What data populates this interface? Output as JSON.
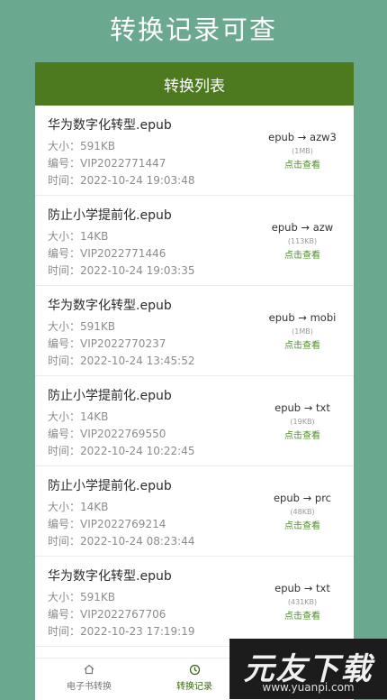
{
  "headline": "转换记录可查",
  "card": {
    "title": "转换列表"
  },
  "labels": {
    "size": "大小：",
    "id": "编号：",
    "time": "时间："
  },
  "records": [
    {
      "name": "华为数字化转型.epub",
      "size": "591KB",
      "id": "VIP2022771447",
      "time": "2022-10-24 19:03:48",
      "format": "epub → azw3",
      "filesize": "(1MB)",
      "action": "点击查看"
    },
    {
      "name": "防止小学提前化.epub",
      "size": "14KB",
      "id": "VIP2022771446",
      "time": "2022-10-24 19:03:35",
      "format": "epub → azw",
      "filesize": "(113KB)",
      "action": "点击查看"
    },
    {
      "name": "华为数字化转型.epub",
      "size": "591KB",
      "id": "VIP2022770237",
      "time": "2022-10-24 13:45:52",
      "format": "epub → mobi",
      "filesize": "(1MB)",
      "action": "点击查看"
    },
    {
      "name": "防止小学提前化.epub",
      "size": "14KB",
      "id": "VIP2022769550",
      "time": "2022-10-24 10:22:45",
      "format": "epub → txt",
      "filesize": "(19KB)",
      "action": "点击查看"
    },
    {
      "name": "防止小学提前化.epub",
      "size": "14KB",
      "id": "VIP2022769214",
      "time": "2022-10-24 08:23:44",
      "format": "epub → prc",
      "filesize": "(48KB)",
      "action": "点击查看"
    },
    {
      "name": "华为数字化转型.epub",
      "size": "591KB",
      "id": "VIP2022767706",
      "time": "2022-10-23 17:19:19",
      "format": "epub → txt",
      "filesize": "(431KB)",
      "action": "点击查看"
    }
  ],
  "tabs": [
    {
      "label": "电子书转换",
      "icon": "home-icon"
    },
    {
      "label": "转换记录",
      "icon": "history-icon"
    }
  ],
  "watermark": {
    "brand": "元友下载",
    "url": "www.yuanpi.com"
  }
}
